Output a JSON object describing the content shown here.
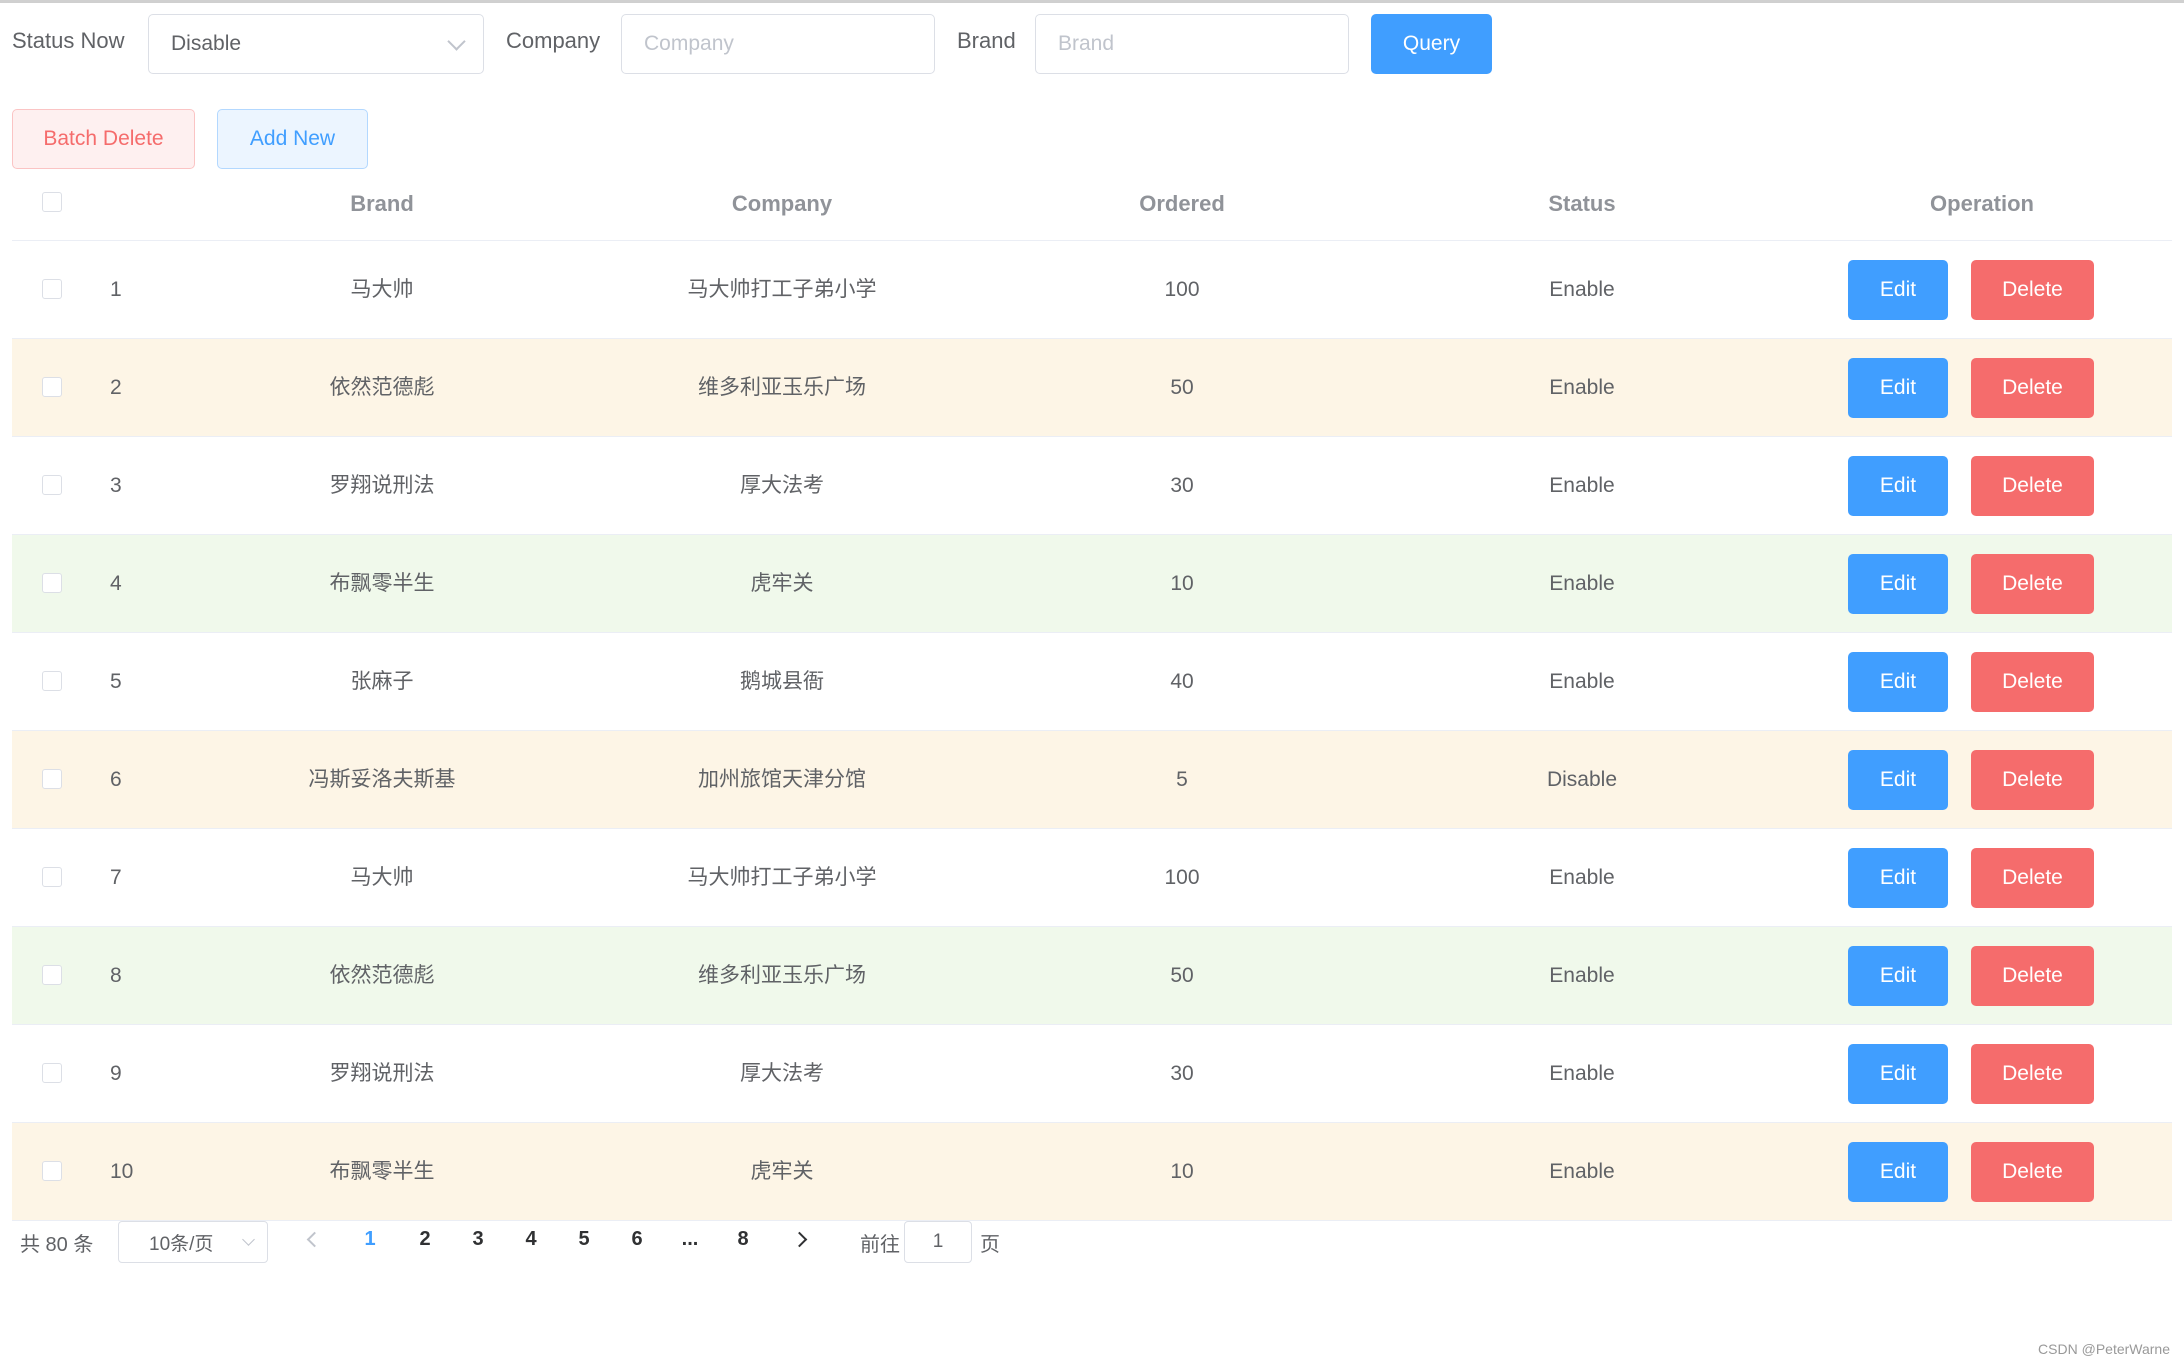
{
  "filters": {
    "status_label": "Status Now",
    "status_value": "Disable",
    "company_label": "Company",
    "company_placeholder": "Company",
    "brand_label": "Brand",
    "brand_placeholder": "Brand",
    "query_label": "Query"
  },
  "actions": {
    "batch_delete_label": "Batch Delete",
    "add_new_label": "Add New"
  },
  "table": {
    "columns": [
      "Brand",
      "Company",
      "Ordered",
      "Status",
      "Operation"
    ],
    "edit_label": "Edit",
    "delete_label": "Delete",
    "rows": [
      {
        "index": "1",
        "brand": "马大帅",
        "company": "马大帅打工子弟小学",
        "ordered": "100",
        "status": "Enable"
      },
      {
        "index": "2",
        "brand": "依然范德彪",
        "company": "维多利亚玉乐广场",
        "ordered": "50",
        "status": "Enable"
      },
      {
        "index": "3",
        "brand": "罗翔说刑法",
        "company": "厚大法考",
        "ordered": "30",
        "status": "Enable"
      },
      {
        "index": "4",
        "brand": "布飘零半生",
        "company": "虎牢关",
        "ordered": "10",
        "status": "Enable"
      },
      {
        "index": "5",
        "brand": "张麻子",
        "company": "鹅城县衙",
        "ordered": "40",
        "status": "Enable"
      },
      {
        "index": "6",
        "brand": "冯斯妥洛夫斯基",
        "company": "加州旅馆天津分馆",
        "ordered": "5",
        "status": "Disable"
      },
      {
        "index": "7",
        "brand": "马大帅",
        "company": "马大帅打工子弟小学",
        "ordered": "100",
        "status": "Enable"
      },
      {
        "index": "8",
        "brand": "依然范德彪",
        "company": "维多利亚玉乐广场",
        "ordered": "50",
        "status": "Enable"
      },
      {
        "index": "9",
        "brand": "罗翔说刑法",
        "company": "厚大法考",
        "ordered": "30",
        "status": "Enable"
      },
      {
        "index": "10",
        "brand": "布飘零半生",
        "company": "虎牢关",
        "ordered": "10",
        "status": "Enable"
      }
    ],
    "row_styles": [
      "",
      "warning",
      "",
      "success",
      "",
      "warning",
      "",
      "success",
      "",
      "warning"
    ]
  },
  "pagination": {
    "total_text": "共 80 条",
    "page_size": "10条/页",
    "pages": [
      "1",
      "2",
      "3",
      "4",
      "5",
      "6",
      "...",
      "8"
    ],
    "current_page": "1",
    "goto_label": "前往",
    "jump_value": "1",
    "unit_label": "页"
  },
  "watermark": "CSDN @PeterWarne"
}
